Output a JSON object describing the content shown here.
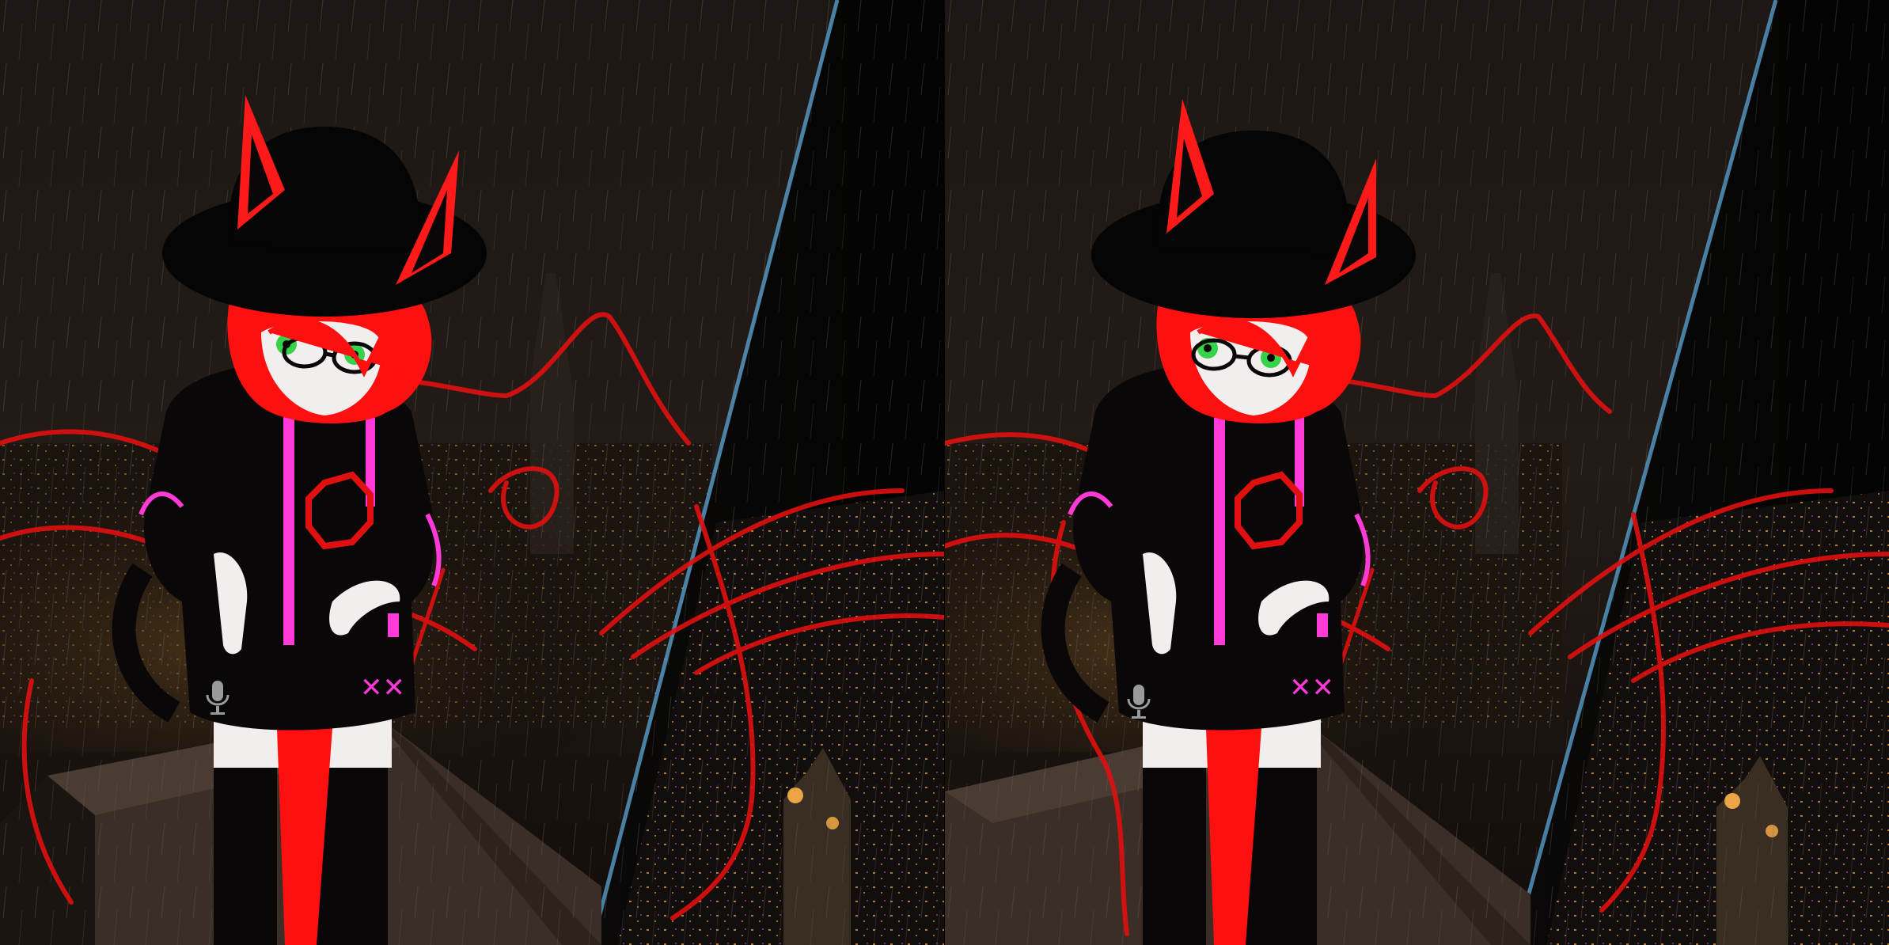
{
  "view": {
    "mode": "stereoscopic-vr-capture",
    "eyes": [
      "left",
      "right"
    ]
  },
  "scene": {
    "setting": "rooftop-at-night-in-rain",
    "background_color": "#1a1411",
    "window_edge_color": "#5aa6d6",
    "city_lights_color": "#ffb24a",
    "rain": true
  },
  "avatar": {
    "hair_color": "#ff1010",
    "ear_color": "#ff1a1a",
    "hat_color": "#050505",
    "hoodie_color": "#0a0708",
    "accent_color": "#ff3ad6",
    "eye_color": "#35d24a",
    "skin_color": "#f2eeee"
  },
  "overlay": {
    "stroke_color": "#e01010",
    "microphone_icon": "microphone-icon"
  }
}
